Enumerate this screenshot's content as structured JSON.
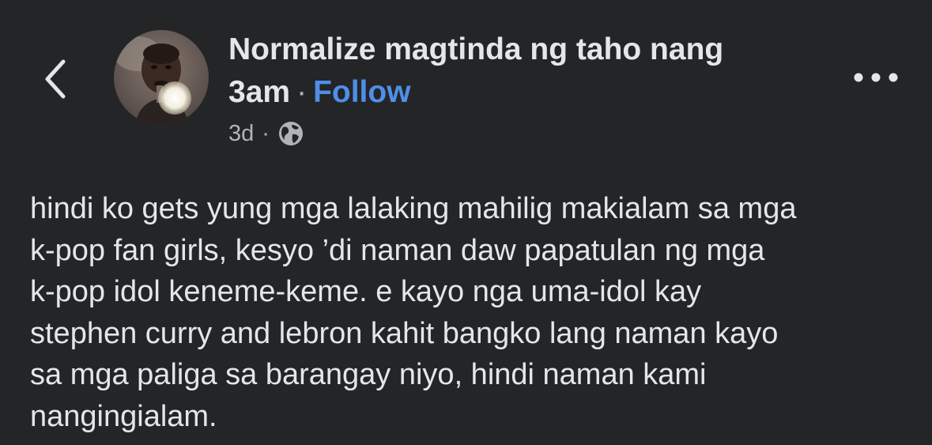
{
  "header": {
    "title_line1": "Normalize magtinda ng taho nang",
    "title_line2": "3am",
    "separator": "·",
    "follow_label": "Follow",
    "time": "3d",
    "meta_separator": "·",
    "back_icon": "chevron-left-icon",
    "privacy_icon": "globe-icon",
    "more_icon": "more-horizontal-icon"
  },
  "post": {
    "text": "hindi ko gets yung mga lalaking mahilig makialam sa mga\nk-pop fan girls, kesyo ’di naman daw papatulan ng mga\nk-pop idol keneme-keme. e kayo nga uma-idol kay\nstephen curry and lebron kahit bangko lang naman kayo\nsa mga paliga sa barangay niyo, hindi naman kami\nnangingialam."
  },
  "colors": {
    "background": "#242526",
    "text": "#e4e6eb",
    "secondary_text": "#b0b3b8",
    "link": "#4f8fe8"
  }
}
